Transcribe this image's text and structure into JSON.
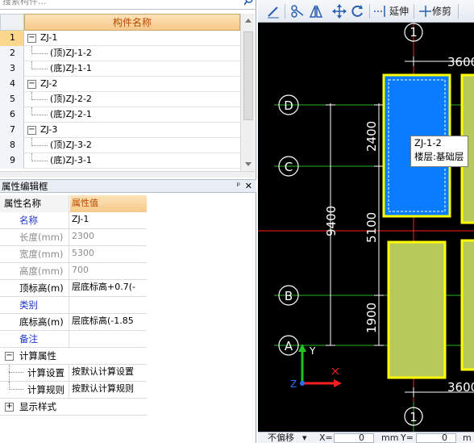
{
  "search": {
    "placeholder": "搜索构件..."
  },
  "tree": {
    "header": "构件名称",
    "rows": [
      {
        "num": "1",
        "label": "ZJ-1",
        "level": 0,
        "expander": "−"
      },
      {
        "num": "2",
        "label": "(顶)ZJ-1-2",
        "level": 1
      },
      {
        "num": "3",
        "label": "(底)ZJ-1-1",
        "level": 1
      },
      {
        "num": "4",
        "label": "ZJ-2",
        "level": 0,
        "expander": "−"
      },
      {
        "num": "5",
        "label": "(顶)ZJ-2-2",
        "level": 1
      },
      {
        "num": "6",
        "label": "(底)ZJ-2-1",
        "level": 1
      },
      {
        "num": "7",
        "label": "ZJ-3",
        "level": 0,
        "expander": "−"
      },
      {
        "num": "8",
        "label": "(顶)ZJ-3-2",
        "level": 1
      },
      {
        "num": "9",
        "label": "(底)ZJ-3-1",
        "level": 1
      }
    ]
  },
  "property_panel": {
    "title": "属性编辑框",
    "pin": "ᵖ",
    "close": "✕",
    "col_name": "属性名称",
    "col_value": "属性值",
    "rows": [
      {
        "name": "名称",
        "value": "ZJ-1",
        "style": "blue"
      },
      {
        "name": "长度(mm)",
        "value": "2300",
        "style": "grey"
      },
      {
        "name": "宽度(mm)",
        "value": "5300",
        "style": "grey"
      },
      {
        "name": "高度(mm)",
        "value": "700",
        "style": "grey"
      },
      {
        "name": "顶标高(m)",
        "value": "层底标高+0.7(-",
        "style": "black"
      },
      {
        "name": "类别",
        "value": "",
        "style": "blue"
      },
      {
        "name": "底标高(m)",
        "value": "层底标高(-1.85",
        "style": "black"
      },
      {
        "name": "备注",
        "value": "",
        "style": "blue"
      }
    ],
    "groups": [
      {
        "label": "计算属性",
        "expander": "−",
        "children": [
          {
            "name": "计算设置",
            "value": "按默认计算设置"
          },
          {
            "name": "计算规则",
            "value": "按默认计算规则"
          }
        ]
      },
      {
        "label": "显示样式",
        "expander": "+"
      }
    ]
  },
  "toolbar": {
    "extend_label": "延伸",
    "trim_label": "修剪",
    "icons": [
      "brush-icon",
      "break-icon",
      "mirror-icon",
      "move-icon",
      "rotate-icon",
      "extend-icon",
      "trim-icon"
    ]
  },
  "canvas": {
    "axis_labels": {
      "top_num": "1",
      "bottom_num": "1",
      "D": "D",
      "C": "C",
      "B": "B",
      "A": "A"
    },
    "dims": {
      "top": "3600",
      "bottom": "3600",
      "d1": "2400",
      "d2": "5100",
      "d3": "1900",
      "total": "9400"
    },
    "ucs": {
      "x": "X",
      "y": "Y",
      "z": "Z"
    },
    "tooltip": {
      "line1": "ZJ-1-2",
      "line2": "楼层:基础层"
    },
    "colors": {
      "background": "#000000",
      "selected_fill": "#0a7cff",
      "foundation_fill": "#b7c95a",
      "outline": "#ffff00",
      "axis_red": "#ff2020",
      "axis_green": "#21c421"
    }
  },
  "status": {
    "mode": "不偏移",
    "x_label": "X=",
    "x_value": "0",
    "unit": "mm",
    "y_label": "Y=",
    "y_value": "0",
    "unit2": "m"
  }
}
